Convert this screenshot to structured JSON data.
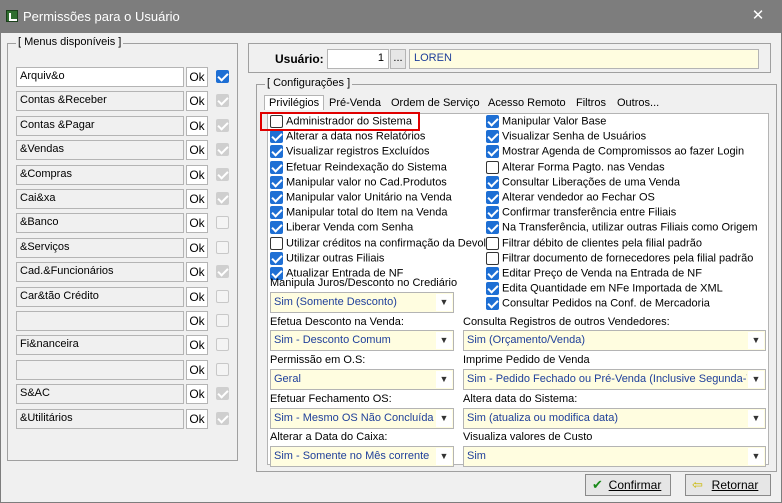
{
  "window": {
    "title": "Permissões para o Usuário",
    "close_icon": "close-icon"
  },
  "menus": {
    "title": "[  Menus disponíveis  ]",
    "ok_label": "Ok",
    "items": [
      {
        "label": "Arquiv&o",
        "checked": true,
        "disabled": false,
        "active": true
      },
      {
        "label": "Contas &Receber",
        "checked": true,
        "disabled": true
      },
      {
        "label": "Contas &Pagar",
        "checked": true,
        "disabled": true
      },
      {
        "label": "&Vendas",
        "checked": true,
        "disabled": true
      },
      {
        "label": "&Compras",
        "checked": true,
        "disabled": true
      },
      {
        "label": "Cai&xa",
        "checked": true,
        "disabled": true
      },
      {
        "label": "&Banco",
        "checked": false,
        "disabled": true
      },
      {
        "label": "&Serviços",
        "checked": false,
        "disabled": true
      },
      {
        "label": "Cad.&Funcionários",
        "checked": true,
        "disabled": true
      },
      {
        "label": "Car&tão Crédito",
        "checked": false,
        "disabled": true
      },
      {
        "label": "",
        "checked": false,
        "disabled": true
      },
      {
        "label": "Fi&nanceira",
        "checked": false,
        "disabled": true
      },
      {
        "label": "",
        "checked": false,
        "disabled": true
      },
      {
        "label": "S&AC",
        "checked": true,
        "disabled": true
      },
      {
        "label": "&Utilitários",
        "checked": true,
        "disabled": true
      }
    ]
  },
  "user": {
    "label": "Usuário:",
    "id": "1",
    "browse": "...",
    "name": "LOREN"
  },
  "config": {
    "title": "[ Configurações  ]",
    "tabs": [
      "Privilégios",
      "Pré-Venda",
      "Ordem de Serviço",
      "Acesso Remoto",
      "Filtros",
      "Outros..."
    ],
    "left_perms": [
      {
        "label": "Administrador do Sistema",
        "checked": false
      },
      {
        "label": "Alterar a data nos Relatórios",
        "checked": true
      },
      {
        "label": "Visualizar registros Excluídos",
        "checked": true
      },
      {
        "label": "Efetuar Reindexação do Sistema",
        "checked": true
      },
      {
        "label": "Manipular valor no Cad.Produtos",
        "checked": true
      },
      {
        "label": "Manipular valor Unitário na Venda",
        "checked": true
      },
      {
        "label": "Manipular total do Item na Venda",
        "checked": true
      },
      {
        "label": "Liberar Venda com Senha",
        "checked": true
      },
      {
        "label": "Utilizar créditos na confirmação da Devol.",
        "checked": false
      },
      {
        "label": "Utilizar outras Filiais",
        "checked": true
      },
      {
        "label": "Atualizar Entrada de NF",
        "checked": true
      }
    ],
    "right_perms": [
      {
        "label": "Manipular Valor Base",
        "checked": true
      },
      {
        "label": "Visualizar Senha de Usuários",
        "checked": true
      },
      {
        "label": "Mostrar Agenda de Compromissos ao fazer Login",
        "checked": true
      },
      {
        "label": "Alterar Forma Pagto. nas Vendas",
        "checked": false
      },
      {
        "label": "Consultar Liberações de uma Venda",
        "checked": true
      },
      {
        "label": "Alterar vendedor ao Fechar OS",
        "checked": true
      },
      {
        "label": "Confirmar transferência entre Filiais",
        "checked": true
      },
      {
        "label": "Na Transferência, utilizar outras Filiais como Origem",
        "checked": true
      },
      {
        "label": "Filtrar débito de clientes pela filial padrão",
        "checked": false
      },
      {
        "label": "Filtrar documento de fornecedores pela filial padrão",
        "checked": false
      },
      {
        "label": "Editar Preço de Venda na Entrada de NF",
        "checked": true
      },
      {
        "label": "Edita Quantidade em NFe Importada de XML",
        "checked": true
      },
      {
        "label": "Consultar Pedidos na Conf. de Mercadoria",
        "checked": true
      }
    ],
    "selects": {
      "juros_label": "Manipula Juros/Desconto no Crediário",
      "juros_value": "Sim (Somente Desconto)",
      "desconto_label": "Efetua Desconto na Venda:",
      "desconto_value": "Sim - Desconto Comum",
      "registros_label": "Consulta Registros de outros Vendedores:",
      "registros_value": "Sim (Orçamento/Venda)",
      "permissao_label": "Permissão em O.S:",
      "permissao_value": "Geral",
      "imprime_label": "Imprime Pedido de Venda",
      "imprime_value": "Sim - Pedido Fechado ou Pré-Venda (Inclusive Segunda-Via)",
      "fechamento_label": "Efetuar Fechamento OS:",
      "fechamento_value": "Sim - Mesmo OS Não Concluída",
      "altera_label": "Altera data do Sistema:",
      "altera_value": "Sim (atualiza ou modifica data)",
      "caixa_label": "Alterar a Data do Caixa:",
      "caixa_value": "Sim - Somente no Mês corrente",
      "custo_label": "Visualiza valores de Custo",
      "custo_value": "Sim"
    }
  },
  "buttons": {
    "confirm": "Confirmar",
    "back": "Retornar"
  }
}
